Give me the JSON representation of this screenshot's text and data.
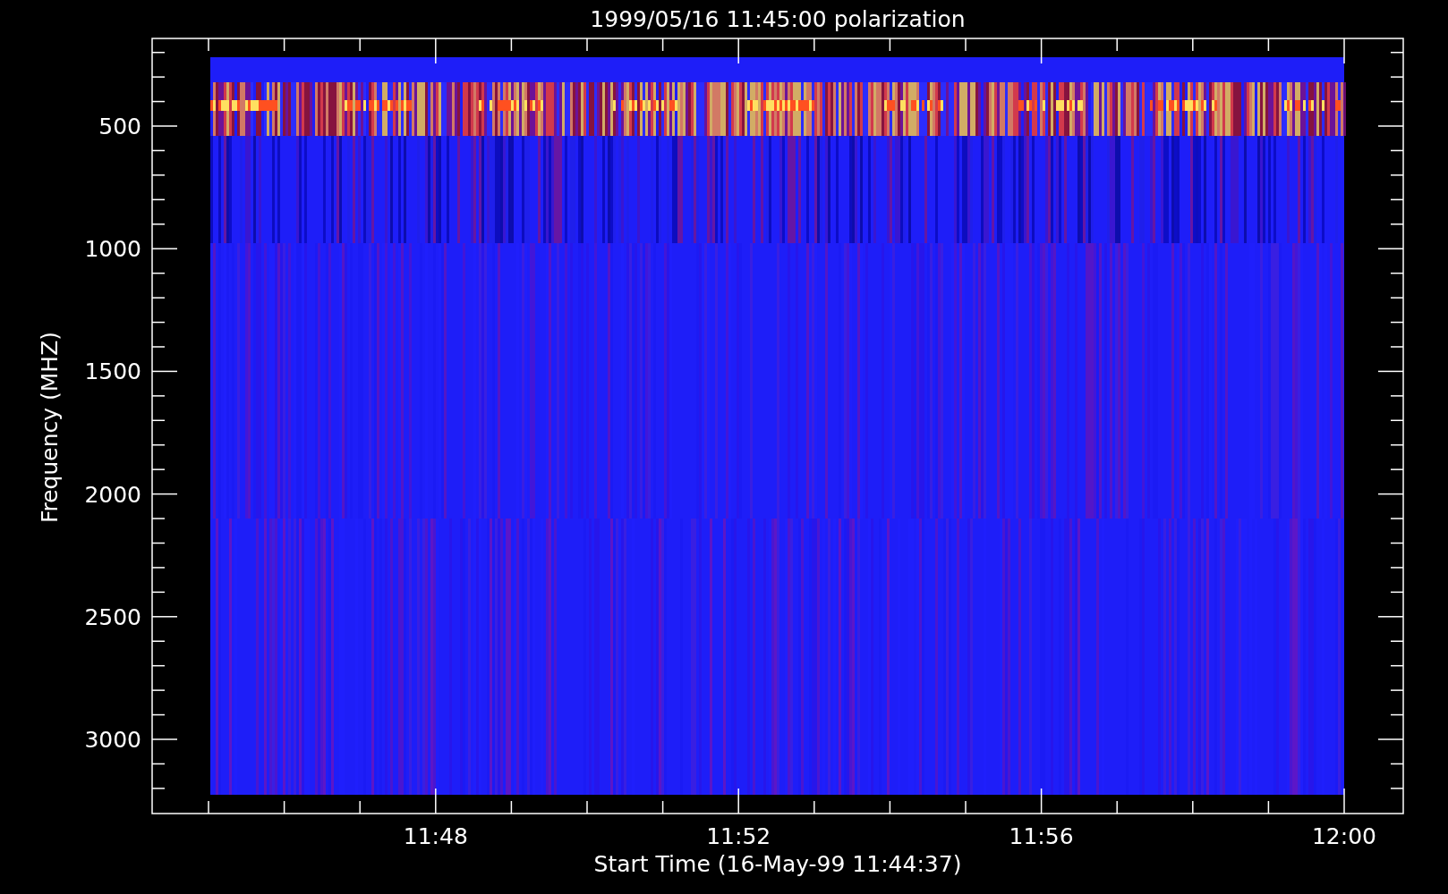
{
  "plot": {
    "title": "1999/05/16 11:45:00 polarization",
    "y_axis": {
      "label": "Frequency (MHZ)",
      "tick_labels": [
        "500",
        "1000",
        "1500",
        "2000",
        "2500",
        "3000"
      ]
    },
    "x_axis": {
      "label": "Start Time (16-May-99 11:44:37)",
      "tick_labels": [
        "11:48",
        "11:52",
        "11:56",
        "12:00"
      ]
    }
  }
}
